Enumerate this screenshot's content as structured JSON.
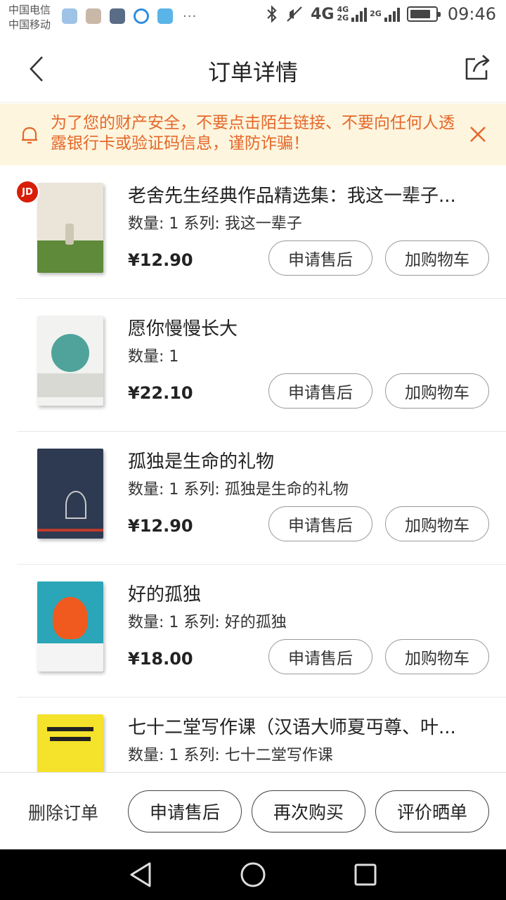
{
  "status_bar": {
    "carrier_1": "中国电信",
    "carrier_2": "中国移动",
    "more": "···",
    "network": "4G",
    "net_small_1": "4G",
    "net_small_2": "2G",
    "net_small_3": "2G",
    "time": "09:46"
  },
  "header": {
    "title": "订单详情"
  },
  "notice": {
    "text": "为了您的财产安全，不要点击陌生链接、不要向任何人透露银行卡或验证码信息，谨防诈骗！"
  },
  "items": [
    {
      "title": "老舍先生经典作品精选集：我这一辈子...",
      "meta": "数量: 1 系列: 我这一辈子",
      "price": "¥12.90",
      "badge": "JD",
      "cover_color": "#eae5d8",
      "accent": "#5f8a3a"
    },
    {
      "title": "愿你慢慢长大",
      "meta": "数量: 1",
      "price": "¥22.10",
      "cover_color": "#f2f2f0",
      "accent": "#4fa39b"
    },
    {
      "title": "孤独是生命的礼物",
      "meta": "数量: 1 系列: 孤独是生命的礼物",
      "price": "¥12.90",
      "cover_color": "#2d3a52",
      "accent": "#c9c9c9"
    },
    {
      "title": "好的孤独",
      "meta": "数量: 1 系列: 好的孤独",
      "price": "¥18.00",
      "cover_color": "#2aa6b8",
      "accent": "#f05a1e"
    },
    {
      "title": "七十二堂写作课（汉语大师夏丏尊、叶...",
      "meta": "数量: 1 系列: 七十二堂写作课",
      "price": "",
      "cover_color": "#f5e22a",
      "accent": "#222222"
    }
  ],
  "item_actions": {
    "after_sale": "申请售后",
    "add_cart": "加购物车"
  },
  "action_bar": {
    "delete": "删除订单",
    "after_sale": "申请售后",
    "rebuy": "再次购买",
    "review": "评价晒单"
  },
  "colors": {
    "notice_bg": "#fdf5de",
    "notice_text": "#e5682a"
  }
}
